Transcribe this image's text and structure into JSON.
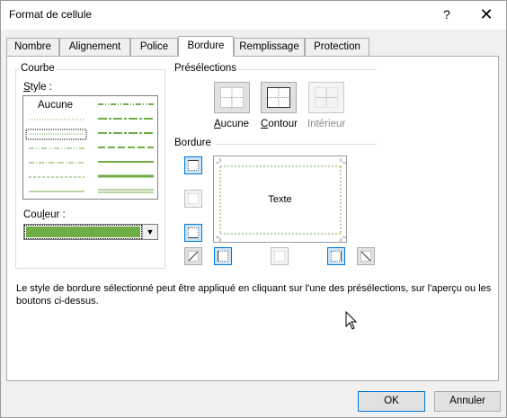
{
  "window": {
    "title": "Format de cellule",
    "help": "?",
    "close": "✕"
  },
  "tabs": [
    "Nombre",
    "Alignement",
    "Police",
    "Bordure",
    "Remplissage",
    "Protection"
  ],
  "active_tab": "Bordure",
  "courbe": {
    "group_label": "Courbe",
    "style_label": "Style :",
    "none_label": "Aucune",
    "color_label": "Couleur :",
    "selected_color": "#70ad47"
  },
  "presets": {
    "group_label": "Présélections",
    "items": [
      {
        "label": "Aucune",
        "enabled": true
      },
      {
        "label": "Contour",
        "enabled": true
      },
      {
        "label": "Intérieur",
        "enabled": false
      }
    ]
  },
  "border": {
    "group_label": "Bordure",
    "preview_text": "Texte"
  },
  "description": "Le style de bordure sélectionné peut être appliqué en cliquant sur l'une des présélections, sur l'aperçu ou les boutons ci-dessus.",
  "buttons": {
    "ok": "OK",
    "cancel": "Annuler"
  },
  "colors": {
    "accent": "#0078d7",
    "line_green": "#70ad47"
  }
}
